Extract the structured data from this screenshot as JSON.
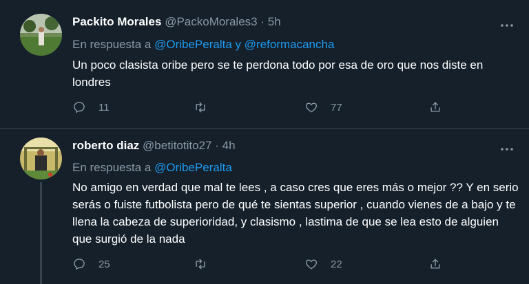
{
  "tweets": [
    {
      "name": "Packito Morales",
      "handle": "@PackoMorales3",
      "separator": "·",
      "time": "5h",
      "reply_prefix": "En respuesta a",
      "reply_users": [
        "@OribePeralta",
        "y",
        "@reformacancha"
      ],
      "text": "Un poco clasista oribe pero se te perdona todo por esa de oro que nos diste en londres",
      "replies": "11",
      "retweets": "",
      "likes": "77"
    },
    {
      "name": "roberto diaz",
      "handle": "@betitotito27",
      "separator": "·",
      "time": "4h",
      "reply_prefix": "En respuesta a",
      "reply_users": [
        "@OribePeralta"
      ],
      "text": "No amigo en verdad que mal te lees , a caso cres que eres más o mejor ?? Y en serio serás o fuiste futbolista pero de qué te sientas superior , cuando vienes de a bajo y te llena la cabeza de superioridad, y clasismo , lastima de que se lea esto de alguien que surgió de la nada",
      "replies": "25",
      "retweets": "",
      "likes": "22"
    }
  ],
  "icons": {
    "more": "more-horizontal-icon",
    "reply": "reply-icon",
    "retweet": "retweet-icon",
    "like": "heart-icon",
    "share": "share-icon"
  },
  "colors": {
    "background": "#15202b",
    "link": "#1d9bf0",
    "muted": "#8899a6",
    "divider": "#38444d"
  }
}
